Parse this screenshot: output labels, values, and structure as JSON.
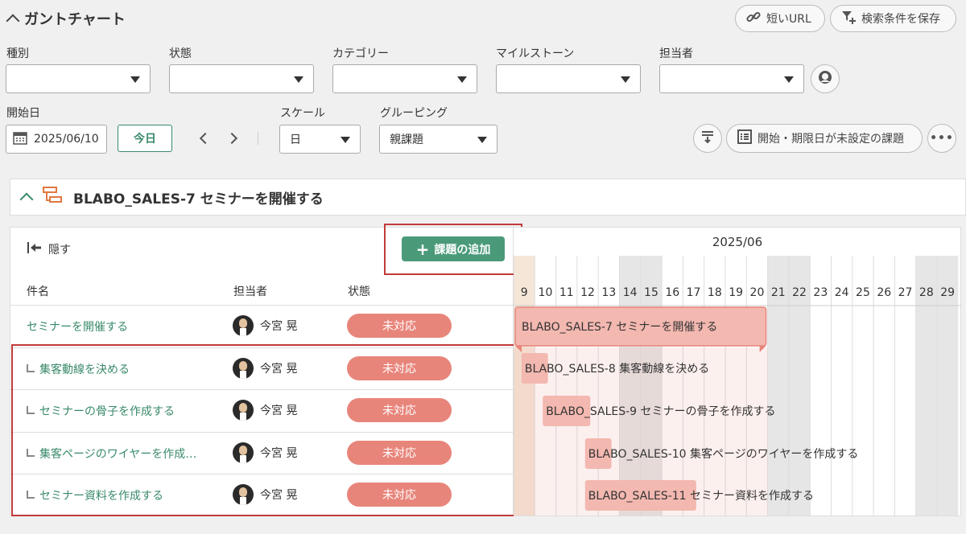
{
  "header": {
    "title": "ガントチャート",
    "short_url_label": "短いURL",
    "save_search_label": "検索条件を保存"
  },
  "filters": {
    "type_label": "種別",
    "status_label": "状態",
    "category_label": "カテゴリー",
    "milestone_label": "マイルストーン",
    "assignee_label": "担当者",
    "start_date_label": "開始日",
    "start_date_value": "2025/06/10",
    "today_label": "今日",
    "scale_label": "スケール",
    "scale_value": "日",
    "grouping_label": "グルーピング",
    "grouping_value": "親課題",
    "unset_issues_label": "開始・期限日が未設定の課題"
  },
  "parent_issue": {
    "title": "BLABO_SALES-7 セミナーを開催する"
  },
  "list": {
    "hide_label": "隠す",
    "add_issue_label": "課題の追加",
    "col_name": "件名",
    "col_assignee": "担当者",
    "col_status": "状態",
    "rows": [
      {
        "name": "セミナーを開催する",
        "assignee": "今宮 晃",
        "status": "未対応",
        "key": "BLABO_SALES-7",
        "bar_title": "セミナーを開催する"
      },
      {
        "name": "集客動線を決める",
        "assignee": "今宮 晃",
        "status": "未対応",
        "key": "BLABO_SALES-8",
        "bar_title": "集客動線を決める"
      },
      {
        "name": "セミナーの骨子を作成する",
        "assignee": "今宮 晃",
        "status": "未対応",
        "key": "BLABO_SALES-9",
        "bar_title": "セミナーの骨子を作成する"
      },
      {
        "name": "集客ページのワイヤーを作成…",
        "assignee": "今宮 晃",
        "status": "未対応",
        "key": "BLABO_SALES-10",
        "bar_title": "集客ページのワイヤーを作成する"
      },
      {
        "name": "セミナー資料を作成する",
        "assignee": "今宮 晃",
        "status": "未対応",
        "key": "BLABO_SALES-11",
        "bar_title": "セミナー資料を作成する"
      }
    ]
  },
  "timeline": {
    "month": "2025/06",
    "days": [
      "9",
      "10",
      "11",
      "12",
      "13",
      "14",
      "15",
      "16",
      "17",
      "18",
      "19",
      "20",
      "21",
      "22",
      "23",
      "24",
      "25",
      "26",
      "27",
      "28",
      "29"
    ],
    "weekend_days": [
      "14",
      "15",
      "21",
      "22",
      "28",
      "29"
    ],
    "today_day": "9"
  },
  "colors": {
    "accent_green": "#4a9a7a",
    "status_red": "#e8857b",
    "highlight_red": "#c23a3a"
  }
}
